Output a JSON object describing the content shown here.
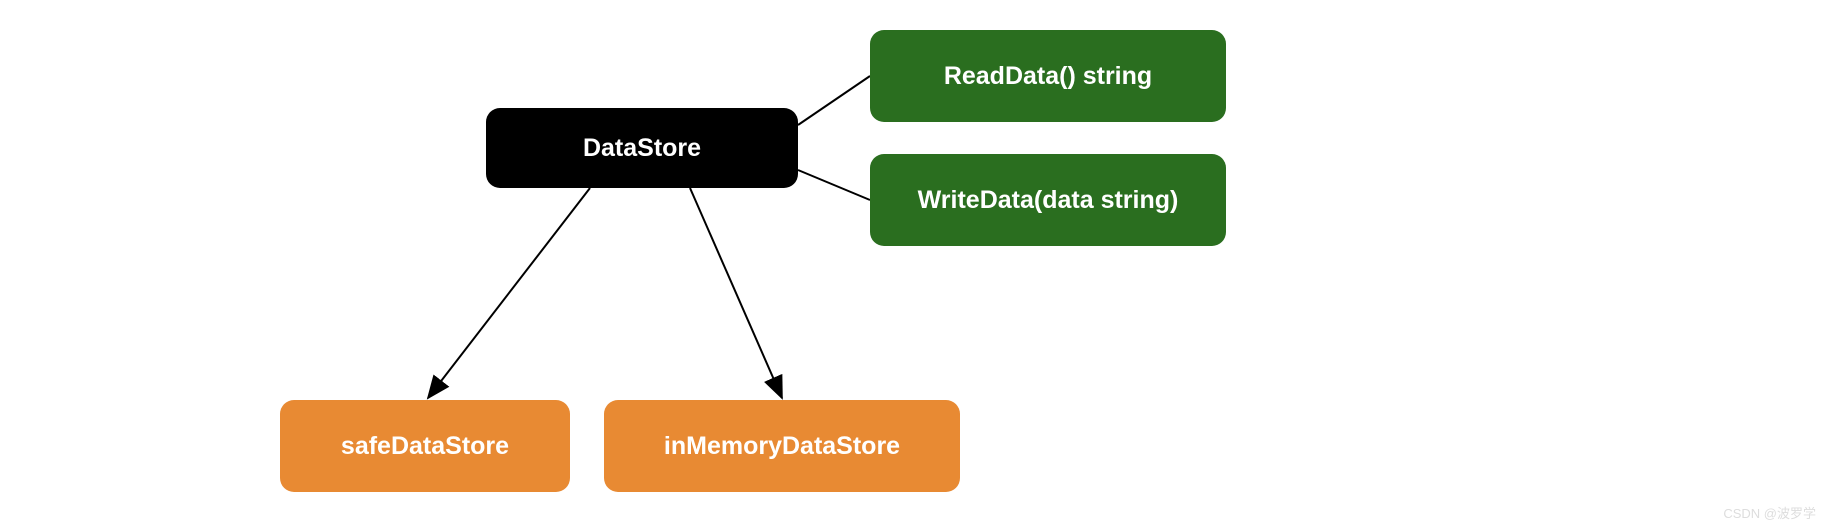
{
  "nodes": {
    "datastore": {
      "label": "DataStore",
      "color": "#000000"
    },
    "readdata": {
      "label": "ReadData() string",
      "color": "#2a6e1f"
    },
    "writedata": {
      "label": "WriteData(data string)",
      "color": "#2a6e1f"
    },
    "safedatastore": {
      "label": "safeDataStore",
      "color": "#e88a33"
    },
    "inmemorydatastore": {
      "label": "inMemoryDataStore",
      "color": "#e88a33"
    }
  },
  "edges": [
    {
      "from": "datastore",
      "to": "readdata",
      "arrow": false
    },
    {
      "from": "datastore",
      "to": "writedata",
      "arrow": false
    },
    {
      "from": "datastore",
      "to": "safedatastore",
      "arrow": true
    },
    {
      "from": "datastore",
      "to": "inmemorydatastore",
      "arrow": true
    }
  ],
  "watermark": "CSDN @波罗学"
}
